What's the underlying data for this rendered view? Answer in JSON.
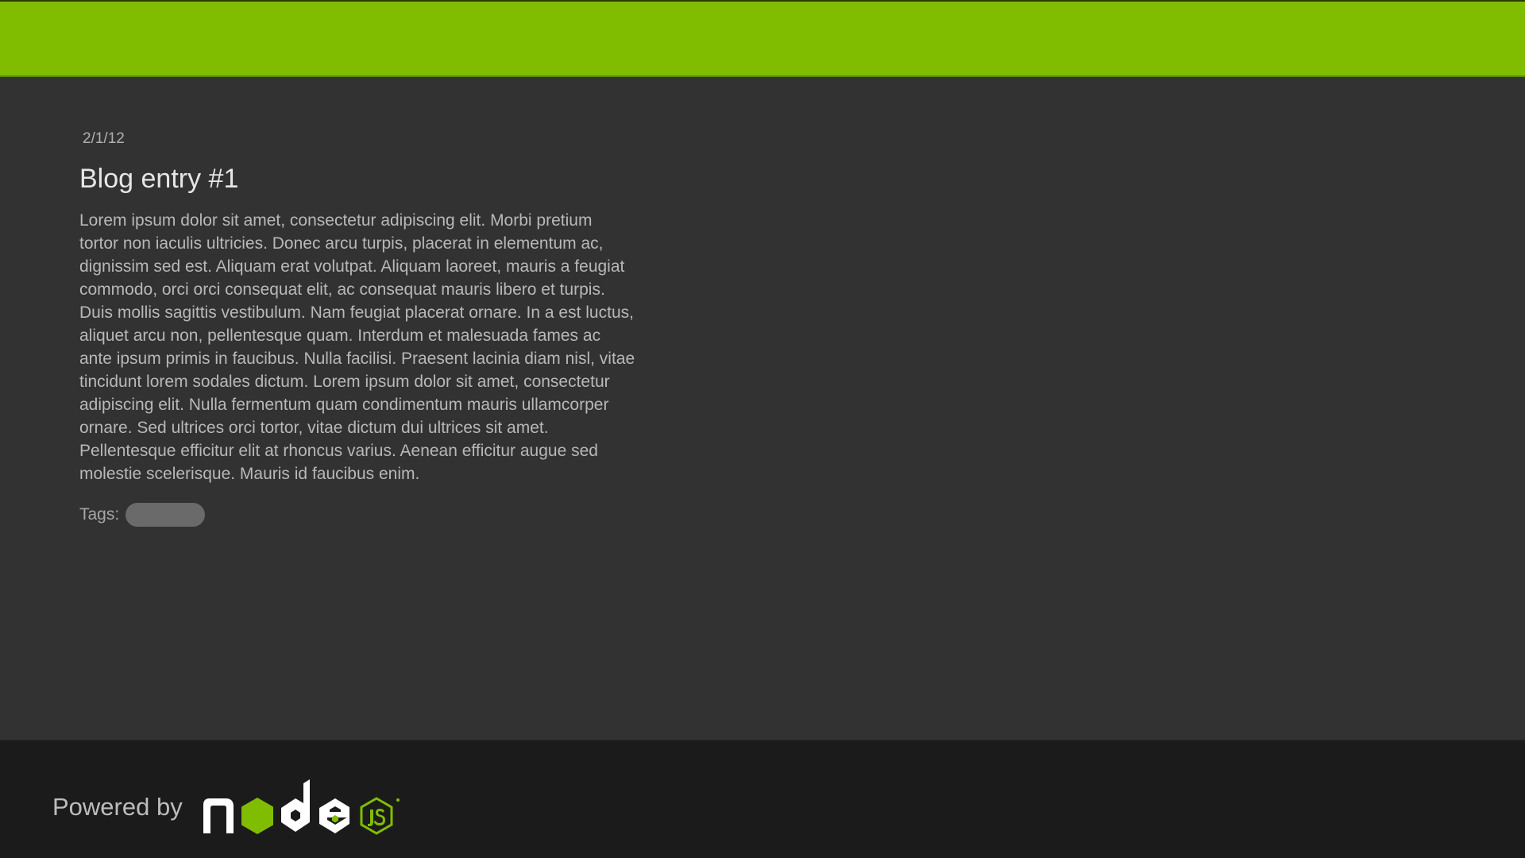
{
  "post": {
    "date": "2/1/12",
    "title": "Blog entry #1",
    "body": "Lorem ipsum dolor sit amet, consectetur adipiscing elit. Morbi pretium tortor non iaculis ultricies. Donec arcu turpis, placerat in elementum ac, dignissim sed est. Aliquam erat volutpat. Aliquam laoreet, mauris a feugiat commodo, orci orci consequat elit, ac consequat mauris libero et turpis. Duis mollis sagittis vestibulum. Nam feugiat placerat ornare. In a est luctus, aliquet arcu non, pellentesque quam. Interdum et malesuada fames ac ante ipsum primis in faucibus. Nulla facilisi. Praesent lacinia diam nisl, vitae tincidunt lorem sodales dictum. Lorem ipsum dolor sit amet, consectetur adipiscing elit. Nulla fermentum quam condimentum mauris ullamcorper ornare. Sed ultrices orci tortor, vitae dictum dui ultrices sit amet. Pellentesque efficitur elit at rhoncus varius. Aenean efficitur augue sed molestie scelerisque. Mauris id faucibus enim.",
    "tags_label": "Tags:",
    "tags": [
      ""
    ]
  },
  "footer": {
    "powered_by": "Powered by",
    "logo_icon": "nodejs-logo-icon"
  },
  "colors": {
    "accent": "#80bd01",
    "background": "#323232",
    "footer_background": "#1b1b1b",
    "tag_pill": "#6a6a6a"
  }
}
